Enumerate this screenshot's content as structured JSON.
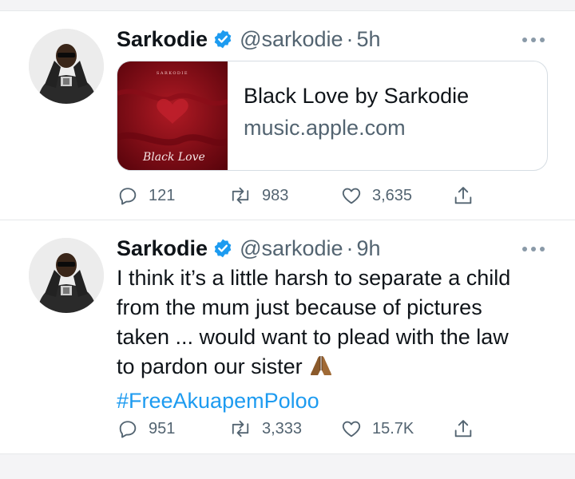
{
  "tweets": [
    {
      "author": "Sarkodie",
      "handle": "@sarkodie",
      "separator": "·",
      "time": "5h",
      "card": {
        "thumb_brand": "SARKODIE",
        "thumb_script": "Black Love",
        "title": "Black Love by Sarkodie",
        "domain": "music.apple.com"
      },
      "actions": {
        "replies": "121",
        "retweets": "983",
        "likes": "3,635"
      }
    },
    {
      "author": "Sarkodie",
      "handle": "@sarkodie",
      "separator": "·",
      "time": "9h",
      "text_lines": [
        "I think it’s a little harsh to separate a child",
        "from the mum just because of pictures",
        "taken ... would want to plead with the law",
        "to pardon our sister"
      ],
      "hashtag": "#FreeAkuapemPoloo",
      "actions": {
        "replies": "951",
        "retweets": "3,333",
        "likes": "15.7K"
      }
    }
  ],
  "icons": {
    "verified": "verified-badge-icon",
    "more": "more-dots-icon",
    "reply": "reply-bubble-icon",
    "retweet": "retweet-arrows-icon",
    "like": "heart-icon",
    "share": "share-upload-icon",
    "emoji": "folded-hands-emoji"
  },
  "colors": {
    "link_blue": "#1d9bf0",
    "secondary_text": "#536471",
    "primary_text": "#0f1419",
    "album_red": "#7c0a14"
  }
}
